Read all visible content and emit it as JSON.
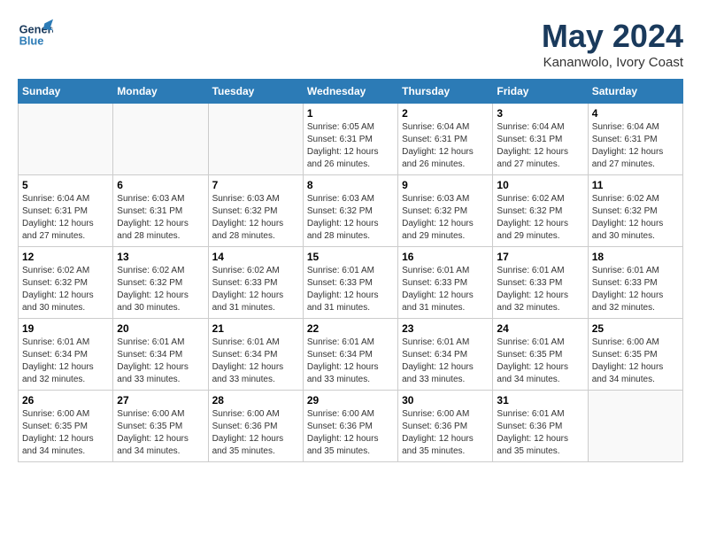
{
  "header": {
    "logo_line1": "General",
    "logo_line2": "Blue",
    "month": "May 2024",
    "location": "Kananwolo, Ivory Coast"
  },
  "weekdays": [
    "Sunday",
    "Monday",
    "Tuesday",
    "Wednesday",
    "Thursday",
    "Friday",
    "Saturday"
  ],
  "weeks": [
    [
      {
        "day": "",
        "info": ""
      },
      {
        "day": "",
        "info": ""
      },
      {
        "day": "",
        "info": ""
      },
      {
        "day": "1",
        "info": "Sunrise: 6:05 AM\nSunset: 6:31 PM\nDaylight: 12 hours\nand 26 minutes."
      },
      {
        "day": "2",
        "info": "Sunrise: 6:04 AM\nSunset: 6:31 PM\nDaylight: 12 hours\nand 26 minutes."
      },
      {
        "day": "3",
        "info": "Sunrise: 6:04 AM\nSunset: 6:31 PM\nDaylight: 12 hours\nand 27 minutes."
      },
      {
        "day": "4",
        "info": "Sunrise: 6:04 AM\nSunset: 6:31 PM\nDaylight: 12 hours\nand 27 minutes."
      }
    ],
    [
      {
        "day": "5",
        "info": "Sunrise: 6:04 AM\nSunset: 6:31 PM\nDaylight: 12 hours\nand 27 minutes."
      },
      {
        "day": "6",
        "info": "Sunrise: 6:03 AM\nSunset: 6:31 PM\nDaylight: 12 hours\nand 28 minutes."
      },
      {
        "day": "7",
        "info": "Sunrise: 6:03 AM\nSunset: 6:32 PM\nDaylight: 12 hours\nand 28 minutes."
      },
      {
        "day": "8",
        "info": "Sunrise: 6:03 AM\nSunset: 6:32 PM\nDaylight: 12 hours\nand 28 minutes."
      },
      {
        "day": "9",
        "info": "Sunrise: 6:03 AM\nSunset: 6:32 PM\nDaylight: 12 hours\nand 29 minutes."
      },
      {
        "day": "10",
        "info": "Sunrise: 6:02 AM\nSunset: 6:32 PM\nDaylight: 12 hours\nand 29 minutes."
      },
      {
        "day": "11",
        "info": "Sunrise: 6:02 AM\nSunset: 6:32 PM\nDaylight: 12 hours\nand 30 minutes."
      }
    ],
    [
      {
        "day": "12",
        "info": "Sunrise: 6:02 AM\nSunset: 6:32 PM\nDaylight: 12 hours\nand 30 minutes."
      },
      {
        "day": "13",
        "info": "Sunrise: 6:02 AM\nSunset: 6:32 PM\nDaylight: 12 hours\nand 30 minutes."
      },
      {
        "day": "14",
        "info": "Sunrise: 6:02 AM\nSunset: 6:33 PM\nDaylight: 12 hours\nand 31 minutes."
      },
      {
        "day": "15",
        "info": "Sunrise: 6:01 AM\nSunset: 6:33 PM\nDaylight: 12 hours\nand 31 minutes."
      },
      {
        "day": "16",
        "info": "Sunrise: 6:01 AM\nSunset: 6:33 PM\nDaylight: 12 hours\nand 31 minutes."
      },
      {
        "day": "17",
        "info": "Sunrise: 6:01 AM\nSunset: 6:33 PM\nDaylight: 12 hours\nand 32 minutes."
      },
      {
        "day": "18",
        "info": "Sunrise: 6:01 AM\nSunset: 6:33 PM\nDaylight: 12 hours\nand 32 minutes."
      }
    ],
    [
      {
        "day": "19",
        "info": "Sunrise: 6:01 AM\nSunset: 6:34 PM\nDaylight: 12 hours\nand 32 minutes."
      },
      {
        "day": "20",
        "info": "Sunrise: 6:01 AM\nSunset: 6:34 PM\nDaylight: 12 hours\nand 33 minutes."
      },
      {
        "day": "21",
        "info": "Sunrise: 6:01 AM\nSunset: 6:34 PM\nDaylight: 12 hours\nand 33 minutes."
      },
      {
        "day": "22",
        "info": "Sunrise: 6:01 AM\nSunset: 6:34 PM\nDaylight: 12 hours\nand 33 minutes."
      },
      {
        "day": "23",
        "info": "Sunrise: 6:01 AM\nSunset: 6:34 PM\nDaylight: 12 hours\nand 33 minutes."
      },
      {
        "day": "24",
        "info": "Sunrise: 6:01 AM\nSunset: 6:35 PM\nDaylight: 12 hours\nand 34 minutes."
      },
      {
        "day": "25",
        "info": "Sunrise: 6:00 AM\nSunset: 6:35 PM\nDaylight: 12 hours\nand 34 minutes."
      }
    ],
    [
      {
        "day": "26",
        "info": "Sunrise: 6:00 AM\nSunset: 6:35 PM\nDaylight: 12 hours\nand 34 minutes."
      },
      {
        "day": "27",
        "info": "Sunrise: 6:00 AM\nSunset: 6:35 PM\nDaylight: 12 hours\nand 34 minutes."
      },
      {
        "day": "28",
        "info": "Sunrise: 6:00 AM\nSunset: 6:36 PM\nDaylight: 12 hours\nand 35 minutes."
      },
      {
        "day": "29",
        "info": "Sunrise: 6:00 AM\nSunset: 6:36 PM\nDaylight: 12 hours\nand 35 minutes."
      },
      {
        "day": "30",
        "info": "Sunrise: 6:00 AM\nSunset: 6:36 PM\nDaylight: 12 hours\nand 35 minutes."
      },
      {
        "day": "31",
        "info": "Sunrise: 6:01 AM\nSunset: 6:36 PM\nDaylight: 12 hours\nand 35 minutes."
      },
      {
        "day": "",
        "info": ""
      }
    ]
  ]
}
